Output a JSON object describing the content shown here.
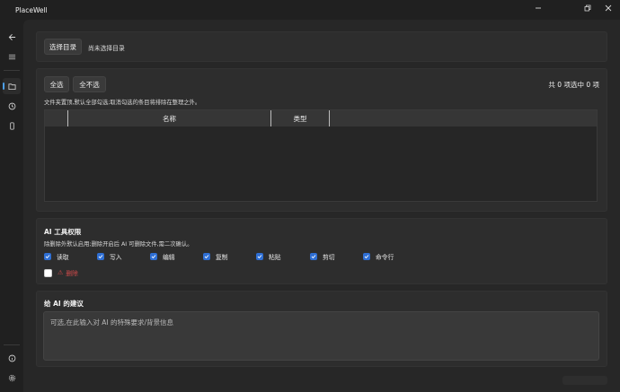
{
  "window": {
    "title": "PlaceWell"
  },
  "directory": {
    "select_button": "选择目录",
    "status": "尚未选择目录"
  },
  "selection": {
    "select_all": "全选",
    "select_none": "全不选",
    "summary": "共 0 项选中 0 项",
    "hint": "文件夹置顶,默认全部勾选;取消勾选的条目将排除在整理之外。"
  },
  "table": {
    "columns": [
      "名称",
      "类型"
    ]
  },
  "permissions": {
    "title": "AI 工具权限",
    "note": "除删除外默认启用;删除开启后 AI 可删除文件,需二次确认。",
    "items": [
      {
        "label": "读取",
        "checked": true
      },
      {
        "label": "写入",
        "checked": true
      },
      {
        "label": "编辑",
        "checked": true
      },
      {
        "label": "复制",
        "checked": true
      },
      {
        "label": "粘贴",
        "checked": true
      },
      {
        "label": "剪切",
        "checked": true
      },
      {
        "label": "命令行",
        "checked": true
      }
    ],
    "delete": {
      "label": "删除",
      "checked": false,
      "icon": "warning-icon"
    }
  },
  "suggestion": {
    "title": "给 AI 的建议",
    "placeholder": "可选,在此输入对 AI 的特殊要求/背景信息"
  },
  "nav": {
    "items": [
      {
        "icon": "back-arrow-icon"
      },
      {
        "icon": "menu-icon"
      },
      {
        "icon": "folder-icon",
        "active": true
      },
      {
        "icon": "history-icon"
      },
      {
        "icon": "phone-icon"
      },
      {
        "icon": "info-icon"
      },
      {
        "icon": "settings-icon"
      }
    ]
  },
  "colors": {
    "accent": "#2f6fd4",
    "danger": "#d24b4b",
    "background": "#202020"
  }
}
